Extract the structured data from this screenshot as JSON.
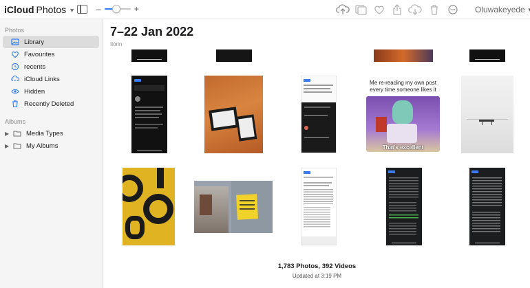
{
  "header": {
    "brand": "iCloud",
    "app": "Photos",
    "user": "Oluwakeyede",
    "zoom_fraction": 0.45,
    "accent": "#2f7cf6"
  },
  "toolbar_icons": [
    "upload-icon",
    "add-to-album-icon",
    "favorite-heart-icon",
    "share-icon",
    "download-icon",
    "trash-icon",
    "more-icon"
  ],
  "sidebar": {
    "sections": [
      {
        "label": "Photos",
        "items": [
          {
            "label": "Library",
            "icon": "library-icon",
            "active": true
          },
          {
            "label": "Favourites",
            "icon": "heart-icon",
            "active": false
          },
          {
            "label": "recents",
            "icon": "clock-icon",
            "active": false
          },
          {
            "label": "iCloud Links",
            "icon": "link-icon",
            "active": false
          },
          {
            "label": "Hidden",
            "icon": "eye-icon",
            "active": false
          },
          {
            "label": "Recently Deleted",
            "icon": "trash-icon",
            "active": false
          }
        ]
      },
      {
        "label": "Albums",
        "items": [
          {
            "label": "Media Types",
            "icon": "folder-icon"
          },
          {
            "label": "My Albums",
            "icon": "folder-icon"
          }
        ]
      }
    ]
  },
  "main": {
    "title": "7–22 Jan 2022",
    "location": "Ilorin",
    "meme_caption_line1": "Me re-reading my own post",
    "meme_caption_line2": "every time someone likes it",
    "meme_overlay": "That's excellent",
    "photo_count": "1,783 Photos, 392 Videos",
    "updated": "Updated at 3:19 PM"
  }
}
